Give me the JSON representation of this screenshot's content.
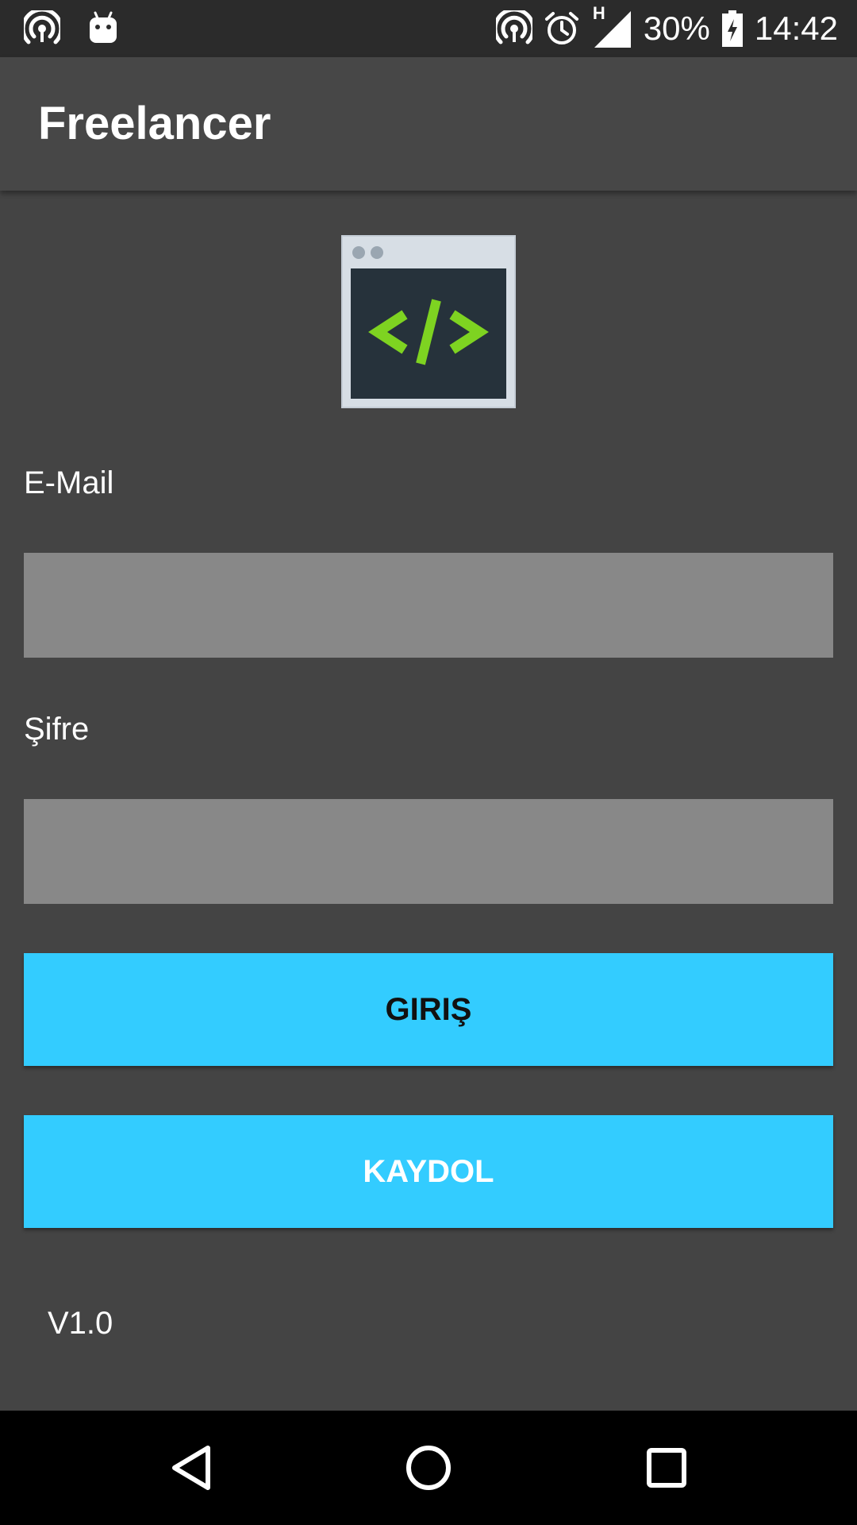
{
  "status_bar": {
    "left_icons": [
      "hotspot-icon",
      "android-icon"
    ],
    "right_icons": [
      "hotspot-icon",
      "alarm-icon",
      "signal-icon",
      "battery-charging-icon"
    ],
    "network_type": "H",
    "battery_percent": "30%",
    "time": "14:42"
  },
  "app_bar": {
    "title": "Freelancer"
  },
  "logo": {
    "icon": "code-window-icon",
    "symbol": "</>",
    "accent_color": "#7ed321"
  },
  "form": {
    "email_label": "E-Mail",
    "email_value": "",
    "password_label": "Şifre",
    "password_value": ""
  },
  "buttons": {
    "login_label": "GIRIŞ",
    "register_label": "KAYDOL",
    "color": "#33ccff"
  },
  "footer": {
    "version": "V1.0"
  },
  "nav_bar": {
    "icons": [
      "back-icon",
      "home-icon",
      "recents-icon"
    ]
  }
}
